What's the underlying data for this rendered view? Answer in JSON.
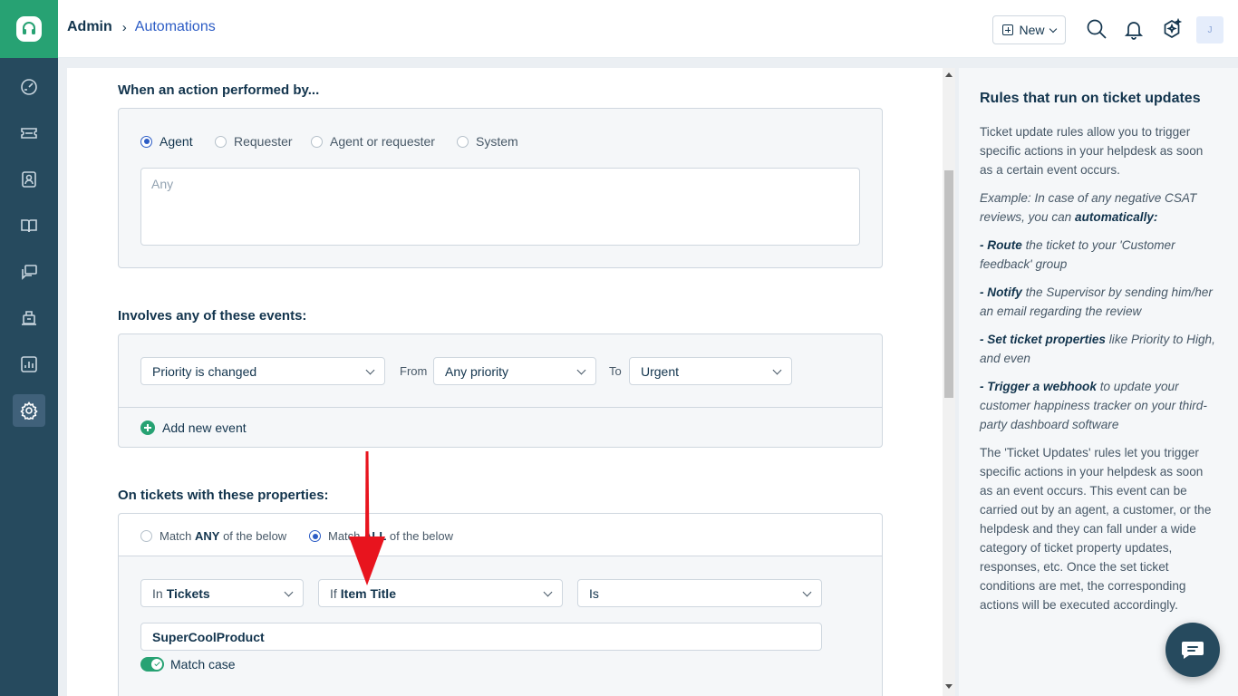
{
  "sidebar": {
    "items": [
      {
        "name": "dashboard"
      },
      {
        "name": "tickets"
      },
      {
        "name": "contacts"
      },
      {
        "name": "solutions"
      },
      {
        "name": "forums"
      },
      {
        "name": "groups"
      },
      {
        "name": "reports"
      },
      {
        "name": "admin",
        "active": true
      }
    ]
  },
  "header": {
    "crumb_root": "Admin",
    "crumb_sep": "›",
    "crumb_current": "Automations",
    "new_label": "New",
    "avatar_initial": "J"
  },
  "section1": {
    "title": "When an action performed by...",
    "radios": [
      {
        "label": "Agent",
        "checked": true
      },
      {
        "label": "Requester",
        "checked": false
      },
      {
        "label": "Agent or requester",
        "checked": false
      },
      {
        "label": "System",
        "checked": false
      }
    ],
    "textarea_placeholder": "Any"
  },
  "section2": {
    "title": "Involves any of these events:",
    "event_select": "Priority is changed",
    "from_label": "From",
    "from_select": "Any priority",
    "to_label": "To",
    "to_select": "Urgent",
    "add_event": "Add new event"
  },
  "section3": {
    "title": "On tickets with these properties:",
    "match_any": {
      "pre": "Match ",
      "bold": "ANY",
      "post": " of the below"
    },
    "match_all": {
      "pre": "Match ",
      "bold": "ALL",
      "post": " of the below"
    },
    "cond_in": {
      "pre": "In",
      "value": "Tickets"
    },
    "cond_if": {
      "pre": "If",
      "value": "Item Title"
    },
    "cond_op": "Is",
    "value_input": "SuperCoolProduct",
    "match_case": "Match case"
  },
  "right_panel": {
    "title": "Rules that run on ticket updates",
    "intro": "Ticket update rules allow you to trigger specific actions in your helpdesk as soon as a certain event occurs.",
    "example_pre": "Example: In case of any negative CSAT reviews, you can ",
    "example_bold": "automatically:",
    "bullets": [
      {
        "bold": "- Route",
        "rest": " the ticket to your 'Customer feedback' group"
      },
      {
        "bold": "- Notify",
        "rest": " the Supervisor by sending him/her an email regarding the review"
      },
      {
        "bold": "- Set ticket properties",
        "rest": " like Priority to High, and even"
      },
      {
        "bold": "- Trigger a webhook",
        "rest": " to update your customer happiness tracker on your third-party dashboard software"
      }
    ],
    "outro": "The 'Ticket Updates' rules let you trigger specific actions in your helpdesk as soon as an event occurs. This event can be carried out by an agent, a customer, or the helpdesk and they can fall under a wide category of ticket property updates, responses, etc. Once the set ticket conditions are met, the corresponding actions will be executed accordingly."
  },
  "colors": {
    "brand_green": "#27a273",
    "sidebar_bg": "#264a5e",
    "link_blue": "#2c5cc5",
    "arrow_red": "#e8141e"
  }
}
